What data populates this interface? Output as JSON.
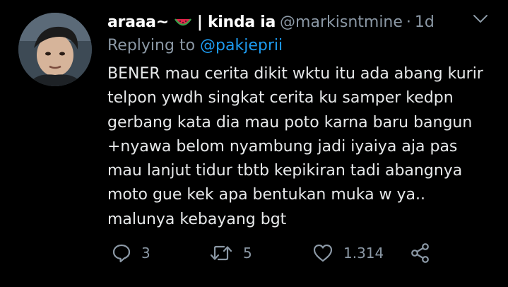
{
  "tweet": {
    "display_name": "araaa~",
    "display_name_suffix": "| kinda ia",
    "handle": "@markisntmine",
    "separator": "·",
    "time": "1d",
    "reply_prefix": "Replying to",
    "reply_mention": "@pakjeprii",
    "body_lines": [
      "BENER mau cerita dikit wktu itu ada abang kurir",
      "telpon ywdh singkat cerita ku samper kedpn",
      "gerbang kata dia mau poto karna baru bangun",
      "+nyawa belom nyambung jadi iyaiya aja pas",
      "mau lanjut tidur tbtb kepikiran tadi abangnya",
      "moto gue kek apa bentukan muka w ya..",
      "malunya kebayang bgt"
    ],
    "emoji_icon": "watermelon-icon",
    "accent_color": "#1d9bf0"
  },
  "actions": {
    "reply_count": "3",
    "retweet_count": "5",
    "like_count": "1.314",
    "icons": [
      "reply-icon",
      "retweet-icon",
      "like-icon",
      "share-icon"
    ]
  }
}
